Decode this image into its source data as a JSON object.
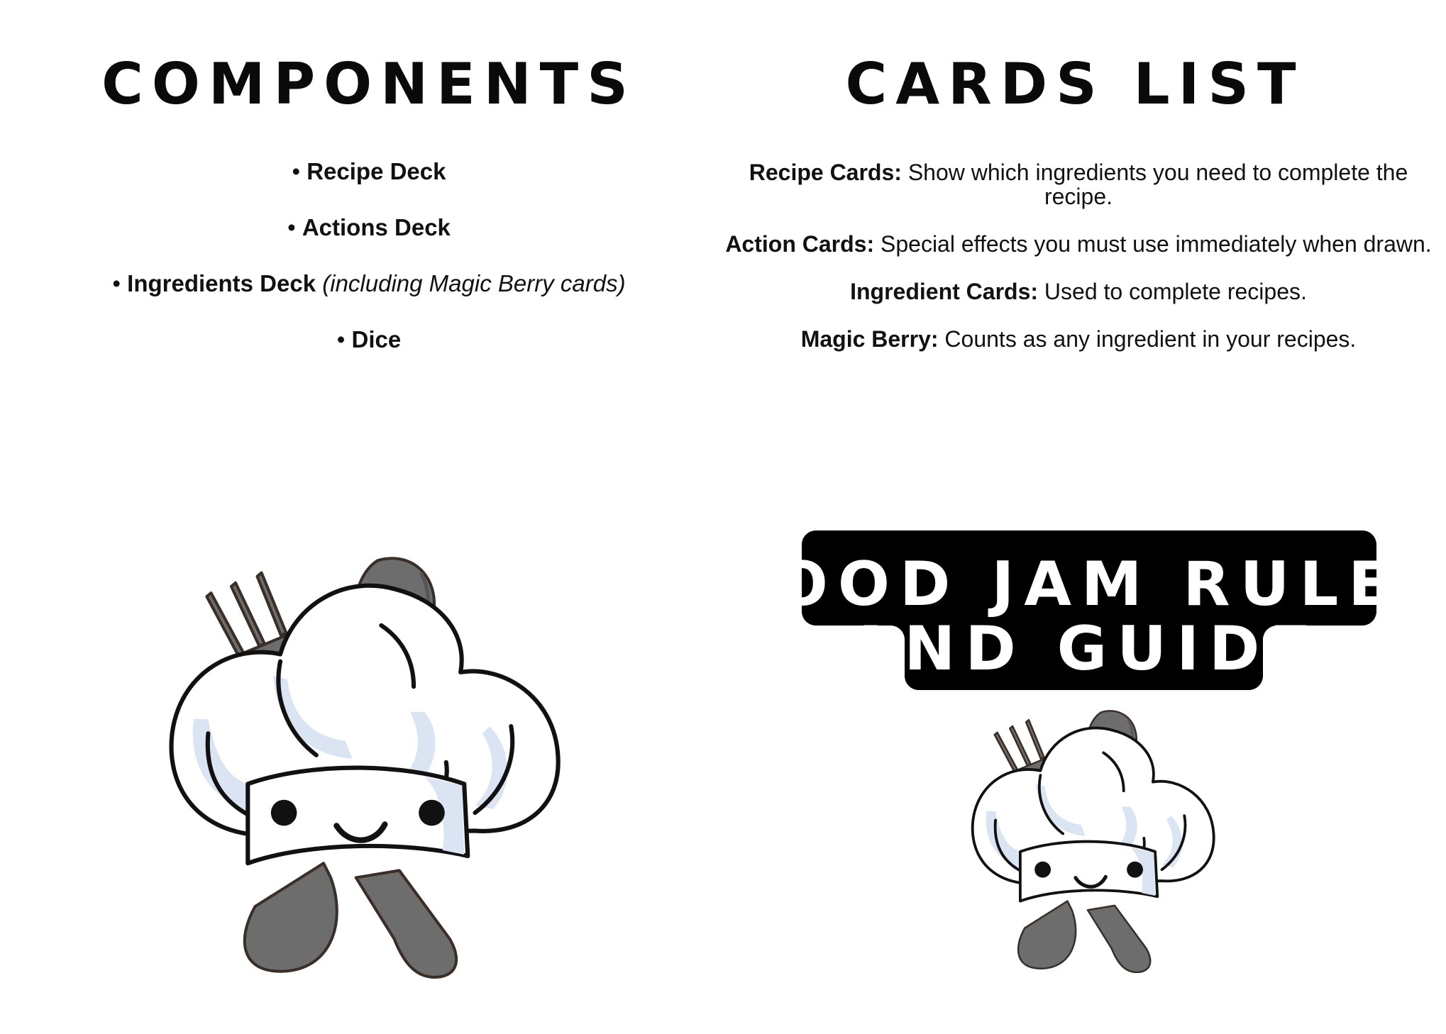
{
  "components": {
    "title": "COMPONENTS",
    "items": [
      {
        "bullet": "•",
        "name": "Recipe Deck",
        "note": ""
      },
      {
        "bullet": "•",
        "name": "Actions Deck",
        "note": ""
      },
      {
        "bullet": "•",
        "name": "Ingredients Deck",
        "note": "(including Magic Berry cards)"
      },
      {
        "bullet": "•",
        "name": "Dice",
        "note": ""
      }
    ]
  },
  "cards_list": {
    "title": "CARDS LIST",
    "entries": [
      {
        "term": "Recipe Cards:",
        "desc": "Show which ingredients you need to complete the recipe."
      },
      {
        "term": "Action Cards:",
        "desc": "Special effects you must use immediately when drawn."
      },
      {
        "term": "Ingredient Cards:",
        "desc": "Used to complete recipes."
      },
      {
        "term": "Magic Berry:",
        "desc": "Counts as any ingredient in your recipes."
      }
    ]
  },
  "cover": {
    "title_line1": "FOOD JAM RULES",
    "title_line2": "AND GUIDE"
  },
  "colors": {
    "ink": "#111111",
    "hat_shade": "#dbe4f3",
    "utensil": "#6d6d6d",
    "utensil_outline": "#3a2f28",
    "badge": "#000000"
  },
  "icons": [
    "chef-hat-mascot-icon",
    "fork-icon",
    "spoon-icon"
  ]
}
